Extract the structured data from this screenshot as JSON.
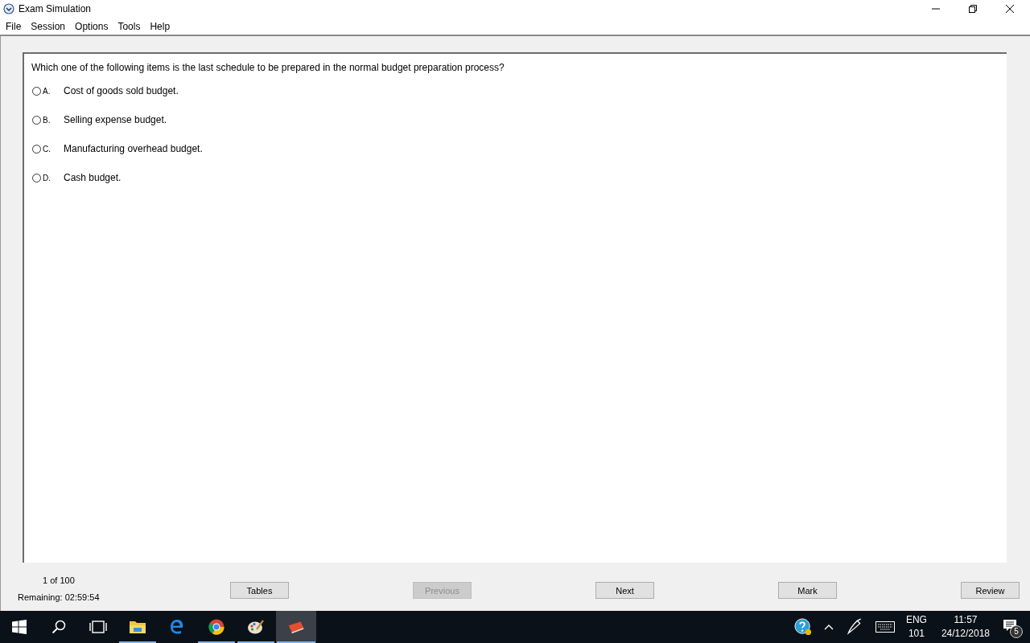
{
  "window": {
    "title": "Exam Simulation"
  },
  "menu": [
    "File",
    "Session",
    "Options",
    "Tools",
    "Help"
  ],
  "question": {
    "text": "Which one of the following items is the last schedule to be prepared in the normal budget preparation process?",
    "options": [
      {
        "letter": "A.",
        "text": "Cost of goods sold budget.",
        "checked": false
      },
      {
        "letter": "B.",
        "text": "Selling expense budget.",
        "checked": false
      },
      {
        "letter": "C.",
        "text": "Manufacturing overhead budget.",
        "checked": false
      },
      {
        "letter": "D.",
        "text": "Cash budget.",
        "checked": false
      }
    ]
  },
  "status": {
    "progress": "1 of 100",
    "remaining": "Remaining: 02:59:54"
  },
  "buttons": [
    {
      "label": "Tables",
      "disabled": false
    },
    {
      "label": "Previous",
      "disabled": true
    },
    {
      "label": "Next",
      "disabled": false
    },
    {
      "label": "Mark",
      "disabled": false
    },
    {
      "label": "Review",
      "disabled": false
    }
  ],
  "taskbar": {
    "apps": [
      {
        "kind": "start",
        "running": false,
        "selected": false
      },
      {
        "kind": "search",
        "running": false,
        "selected": false
      },
      {
        "kind": "taskview",
        "running": false,
        "selected": false
      },
      {
        "kind": "folder",
        "running": true,
        "selected": false
      },
      {
        "kind": "browser-e",
        "running": false,
        "selected": false
      },
      {
        "kind": "browser-round",
        "running": true,
        "selected": false
      },
      {
        "kind": "palette",
        "running": true,
        "selected": false
      },
      {
        "kind": "book",
        "running": true,
        "selected": true
      }
    ],
    "language": "ENG",
    "layout": "101",
    "time": "11:57",
    "date": "24/12/2018",
    "notifications": "5"
  }
}
